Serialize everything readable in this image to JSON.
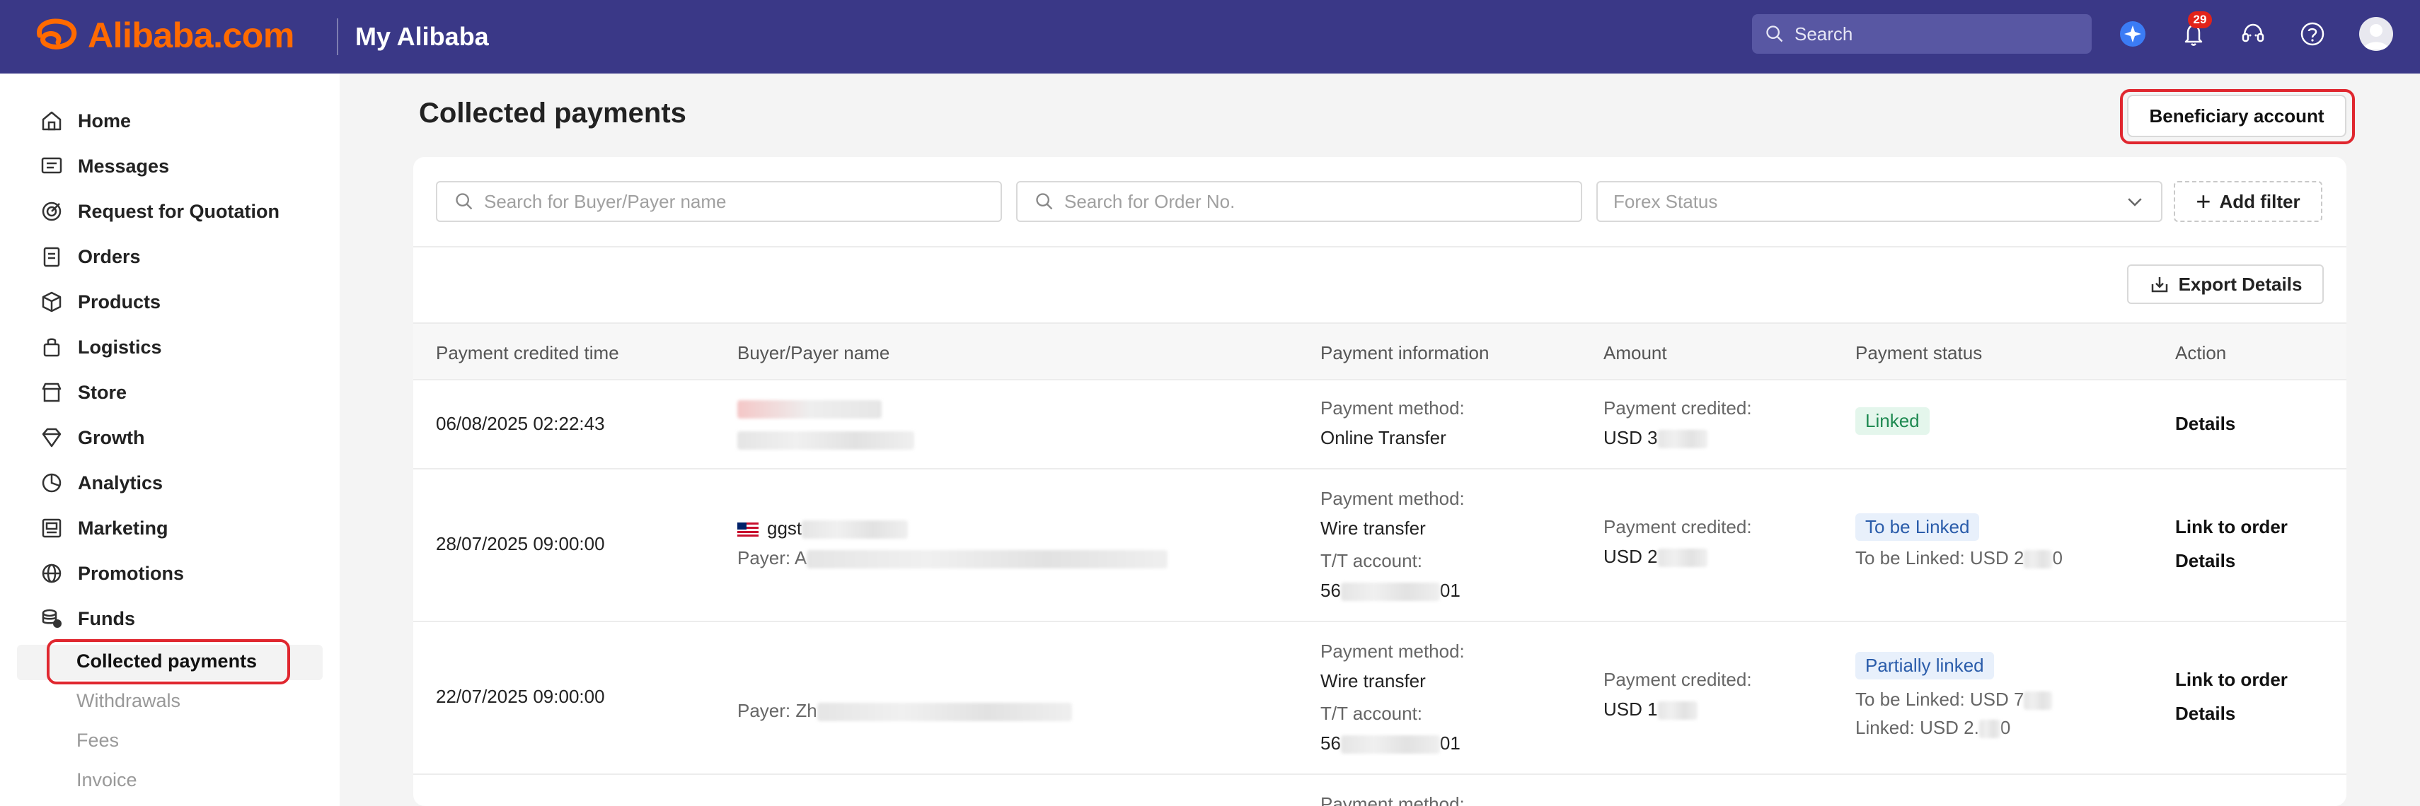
{
  "header": {
    "brand": "Alibaba.com",
    "app_title": "My Alibaba",
    "search_placeholder": "Search",
    "notification_count": "29"
  },
  "sidebar": {
    "items": [
      {
        "label": "Home",
        "icon": "home-icon"
      },
      {
        "label": "Messages",
        "icon": "messages-icon"
      },
      {
        "label": "Request for Quotation",
        "icon": "rfq-icon"
      },
      {
        "label": "Orders",
        "icon": "orders-icon"
      },
      {
        "label": "Products",
        "icon": "products-icon"
      },
      {
        "label": "Logistics",
        "icon": "logistics-icon"
      },
      {
        "label": "Store",
        "icon": "store-icon"
      },
      {
        "label": "Growth",
        "icon": "growth-icon"
      },
      {
        "label": "Analytics",
        "icon": "analytics-icon"
      },
      {
        "label": "Marketing",
        "icon": "marketing-icon"
      },
      {
        "label": "Promotions",
        "icon": "promotions-icon"
      },
      {
        "label": "Funds",
        "icon": "funds-icon"
      }
    ],
    "funds_sub": {
      "active": "Collected payments",
      "others": [
        "Withdrawals",
        "Fees",
        "Invoice"
      ]
    }
  },
  "main": {
    "title": "Collected payments",
    "beneficiary_button": "Beneficiary account",
    "filters": {
      "buyer_placeholder": "Search for Buyer/Payer name",
      "order_placeholder": "Search for Order No.",
      "forex_placeholder": "Forex Status",
      "add_filter": "Add filter"
    },
    "export_button": "Export Details",
    "columns": [
      "Payment credited time",
      "Buyer/Payer name",
      "Payment information",
      "Amount",
      "Payment status",
      "Action"
    ],
    "rows": [
      {
        "time": "06/08/2025 02:22:43",
        "method_label": "Payment method:",
        "method": "Online Transfer",
        "amount_label": "Payment credited:",
        "amount": "USD 3",
        "status": "Linked",
        "actions": [
          "Details"
        ]
      },
      {
        "time": "28/07/2025 09:00:00",
        "buyer": "ggst",
        "payer_prefix": "Payer: A",
        "method_label": "Payment method:",
        "method": "Wire transfer",
        "tt_label": "T/T account:",
        "tt_start": "56",
        "tt_end": "01",
        "amount_label": "Payment credited:",
        "amount": "USD 2",
        "status": "To be Linked",
        "status_detail": "To be Linked: USD 2",
        "status_detail_end": "0",
        "actions": [
          "Link to order",
          "Details"
        ]
      },
      {
        "time": "22/07/2025 09:00:00",
        "payer_prefix": "Payer: Zh",
        "method_label": "Payment method:",
        "method": "Wire transfer",
        "tt_label": "T/T account:",
        "tt_start": "56",
        "tt_end": "01",
        "amount_label": "Payment credited:",
        "amount": "USD 1",
        "status": "Partially linked",
        "status_detail": "To be Linked: USD 7",
        "status_detail_2": "Linked: USD 2.",
        "status_detail_2_end": "0",
        "actions": [
          "Link to order",
          "Details"
        ]
      },
      {
        "method_label": "Payment method:"
      }
    ]
  },
  "colors": {
    "topbar": "#3a3887",
    "brand": "#ff6a00",
    "highlight": "#e0272f",
    "linked_bg": "#e4f6ec",
    "tobe_bg": "#e8f0fb"
  }
}
